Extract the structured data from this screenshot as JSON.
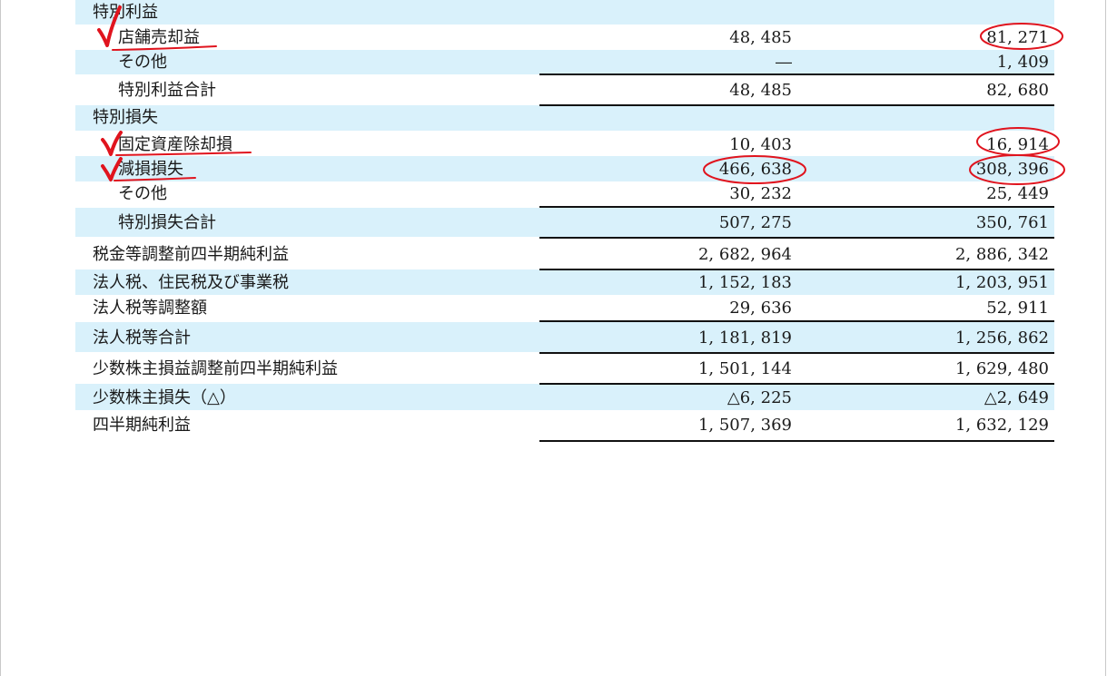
{
  "statement": {
    "rows": [
      {
        "label": "特別利益",
        "v1": "",
        "v2": ""
      },
      {
        "label": "店舗売却益",
        "v1": "48, 485",
        "v2": "81, 271"
      },
      {
        "label": "その他",
        "v1": "―",
        "v2": "1, 409"
      },
      {
        "label": "特別利益合計",
        "v1": "48, 485",
        "v2": "82, 680"
      },
      {
        "label": "特別損失",
        "v1": "",
        "v2": ""
      },
      {
        "label": "固定資産除却損",
        "v1": "10, 403",
        "v2": "16, 914"
      },
      {
        "label": "減損損失",
        "v1": "466, 638",
        "v2": "308, 396"
      },
      {
        "label": "その他",
        "v1": "30, 232",
        "v2": "25, 449"
      },
      {
        "label": "特別損失合計",
        "v1": "507, 275",
        "v2": "350, 761"
      },
      {
        "label": "税金等調整前四半期純利益",
        "v1": "2, 682, 964",
        "v2": "2, 886, 342"
      },
      {
        "label": "法人税、住民税及び事業税",
        "v1": "1, 152, 183",
        "v2": "1, 203, 951"
      },
      {
        "label": "法人税等調整額",
        "v1": "29, 636",
        "v2": "52, 911"
      },
      {
        "label": "法人税等合計",
        "v1": "1, 181, 819",
        "v2": "1, 256, 862"
      },
      {
        "label": "少数株主損益調整前四半期純利益",
        "v1": "1, 501, 144",
        "v2": "1, 629, 480"
      },
      {
        "label": "少数株主損失（△）",
        "v1": "△6, 225",
        "v2": "△2, 649"
      },
      {
        "label": "四半期純利益",
        "v1": "1, 507, 369",
        "v2": "1, 632, 129"
      }
    ]
  },
  "annotations": {
    "ink_color": "#e0141e"
  }
}
